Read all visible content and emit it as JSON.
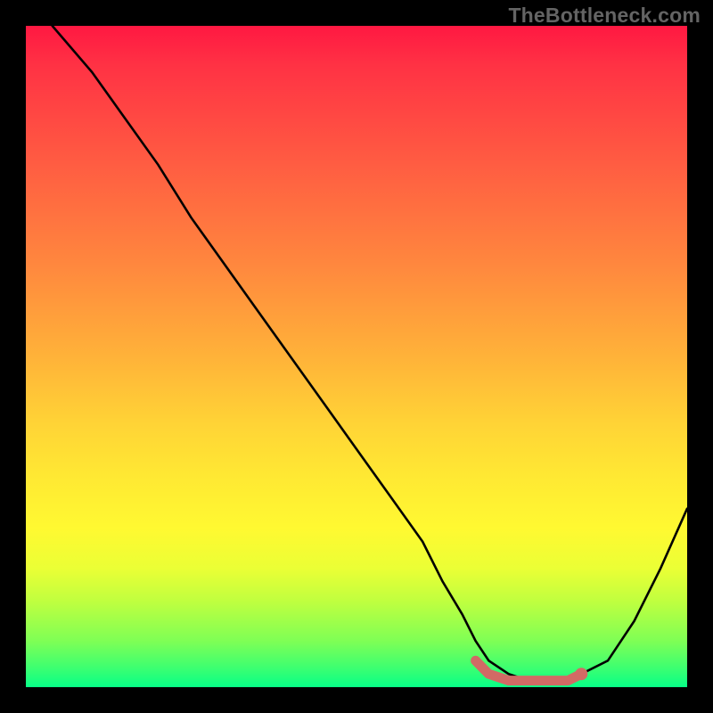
{
  "watermark": "TheBottleneck.com",
  "chart_data": {
    "type": "line",
    "title": "",
    "xlabel": "",
    "ylabel": "",
    "xlim": [
      0,
      100
    ],
    "ylim": [
      0,
      100
    ],
    "grid": false,
    "legend": false,
    "background": "red-yellow-green vertical gradient",
    "series": [
      {
        "name": "bottleneck-curve",
        "color": "#000000",
        "x": [
          4,
          10,
          15,
          20,
          25,
          30,
          35,
          40,
          45,
          50,
          55,
          60,
          63,
          66,
          68,
          70,
          73,
          76,
          79,
          82,
          84,
          88,
          92,
          96,
          100
        ],
        "y": [
          100,
          93,
          86,
          79,
          71,
          64,
          57,
          50,
          43,
          36,
          29,
          22,
          16,
          11,
          7,
          4,
          2,
          1,
          1,
          1,
          2,
          4,
          10,
          18,
          27
        ]
      },
      {
        "name": "optimal-range-marker",
        "color": "#d26a65",
        "style": "thick-round",
        "x": [
          68,
          70,
          73,
          76,
          79,
          82,
          84
        ],
        "y": [
          4,
          2,
          1,
          1,
          1,
          1,
          2
        ]
      }
    ],
    "annotations": []
  }
}
